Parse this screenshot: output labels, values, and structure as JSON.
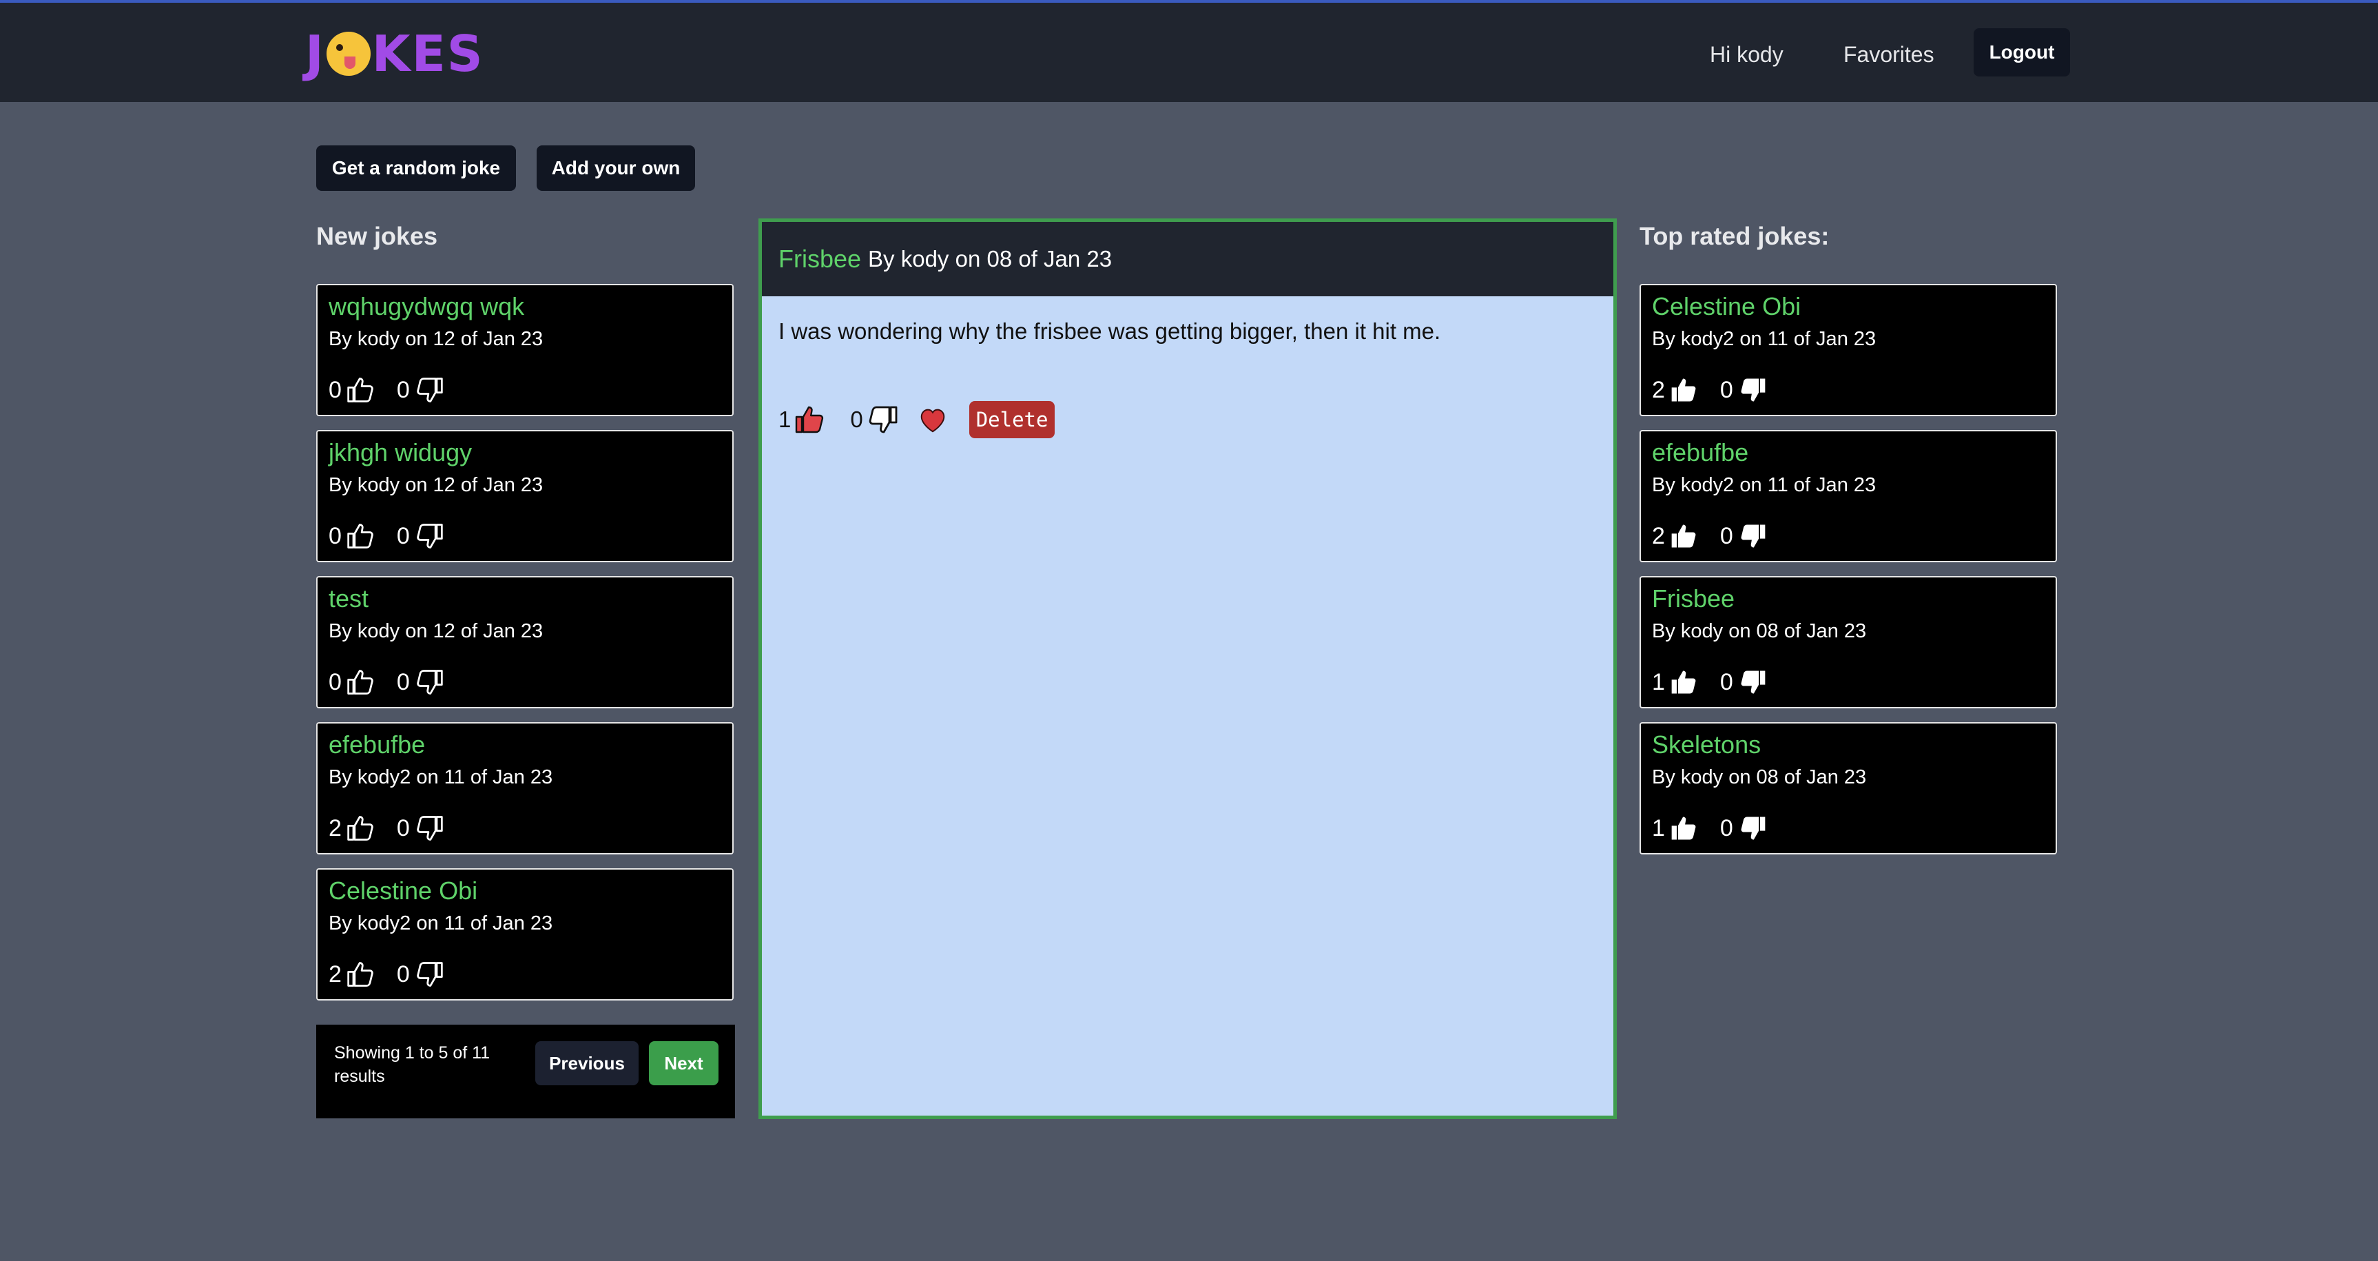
{
  "colors": {
    "accent_green": "#5fd26a",
    "delete_red": "#b0302d",
    "logo_purple": "#a14be6",
    "main_panel_bg": "#c3d9f8"
  },
  "header": {
    "logo_text": "JOKES",
    "logo_left": "J",
    "logo_right": "KES",
    "logo_icon": "zany-face-emoji",
    "greeting": "Hi kody",
    "favorites": "Favorites",
    "logout": "Logout"
  },
  "actions": {
    "random": "Get a random joke",
    "add": "Add your own"
  },
  "new_jokes": {
    "title": "New jokes",
    "items": [
      {
        "title": "wqhugydwgq wqk",
        "meta": "By kody on 12 of Jan 23",
        "up": "0",
        "down": "0"
      },
      {
        "title": "jkhgh widugy",
        "meta": "By kody on 12 of Jan 23",
        "up": "0",
        "down": "0"
      },
      {
        "title": "test",
        "meta": "By kody on 12 of Jan 23",
        "up": "0",
        "down": "0"
      },
      {
        "title": "efebufbe",
        "meta": "By kody2 on 11 of Jan 23",
        "up": "2",
        "down": "0"
      },
      {
        "title": "Celestine Obi",
        "meta": "By kody2 on 11 of Jan 23",
        "up": "2",
        "down": "0"
      }
    ],
    "pagination": {
      "info": "Showing 1 to 5 of 11 results",
      "previous": "Previous",
      "next": "Next"
    }
  },
  "joke": {
    "title": "Frisbee",
    "meta": "By kody on 08 of Jan 23",
    "body": "I was wondering why the frisbee was getting bigger, then it hit me.",
    "up": "1",
    "down": "0",
    "favorited": true,
    "delete": "Delete"
  },
  "top_rated": {
    "title": "Top rated jokes:",
    "items": [
      {
        "title": "Celestine Obi",
        "meta": "By kody2 on 11 of Jan 23",
        "up": "2",
        "down": "0"
      },
      {
        "title": "efebufbe",
        "meta": "By kody2 on 11 of Jan 23",
        "up": "2",
        "down": "0"
      },
      {
        "title": "Frisbee",
        "meta": "By kody on 08 of Jan 23",
        "up": "1",
        "down": "0"
      },
      {
        "title": "Skeletons",
        "meta": "By kody on 08 of Jan 23",
        "up": "1",
        "down": "0"
      }
    ]
  }
}
